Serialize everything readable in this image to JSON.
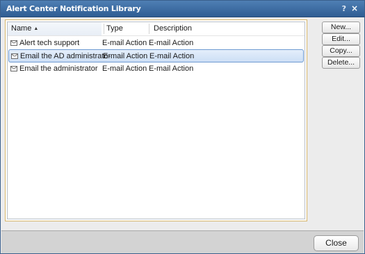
{
  "window": {
    "title": "Alert Center Notification Library",
    "help_glyph": "?",
    "close_glyph": "×"
  },
  "table": {
    "columns": [
      "Name",
      "Type",
      "Description"
    ],
    "sort_indicator": "▲",
    "rows": [
      {
        "name": "Alert tech support",
        "type": "E-mail Action",
        "description": "E-mail Action",
        "icon": "envelope-icon",
        "selected": false
      },
      {
        "name": "Email the AD administrator",
        "type": "E-mail Action",
        "description": "E-mail Action",
        "icon": "envelope-icon",
        "selected": true
      },
      {
        "name": "Email the administrator",
        "type": "E-mail Action",
        "description": "E-mail Action",
        "icon": "envelope-icon",
        "selected": false
      }
    ]
  },
  "buttons": {
    "new_label": "New...",
    "edit_label": "Edit...",
    "copy_label": "Copy...",
    "delete_label": "Delete...",
    "close_label": "Close"
  },
  "colors": {
    "titlebar": "#2f5d93",
    "selection": "#cddff5",
    "list_border": "#d6b56a"
  }
}
